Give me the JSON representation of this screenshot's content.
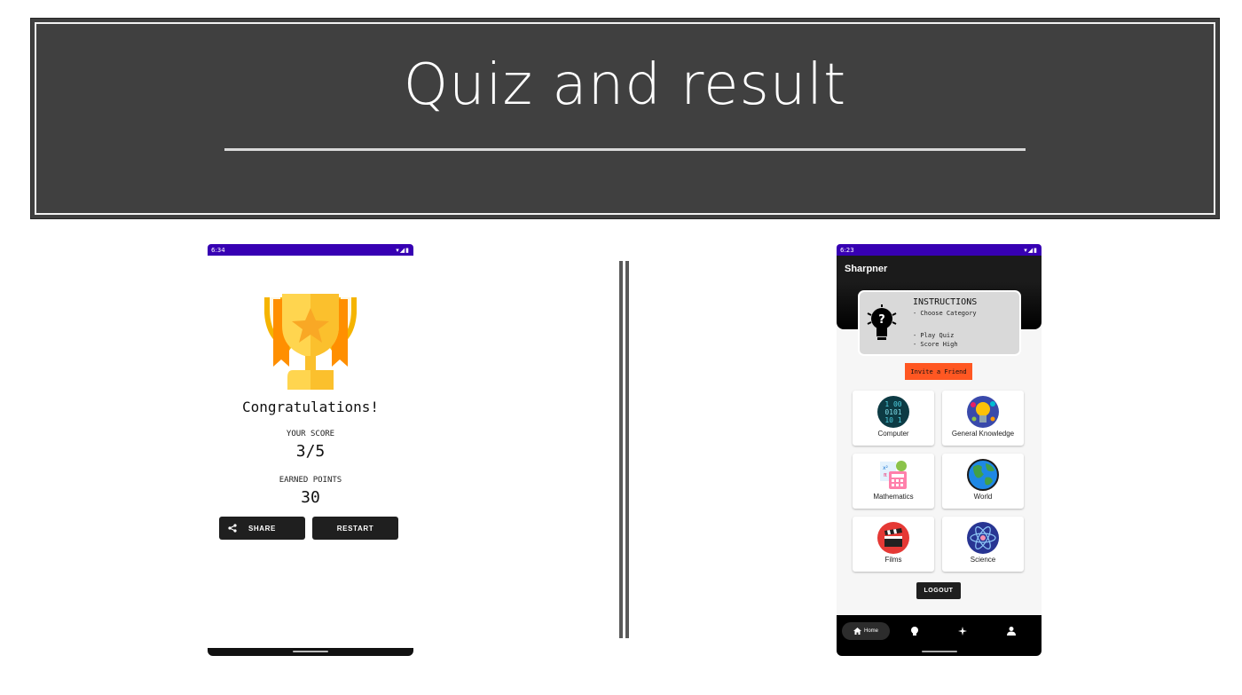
{
  "banner": {
    "title": "Quiz and result"
  },
  "left_phone": {
    "status": {
      "time": "6:34",
      "icons": "▾◢▮"
    },
    "congrats": "Congratulations!",
    "score_label": "YOUR SCORE",
    "score_value": "3/5",
    "points_label": "EARNED POINTS",
    "points_value": "30",
    "share_label": "SHARE",
    "restart_label": "RESTART",
    "icons": {
      "trophy": "trophy-icon",
      "share": "share-icon"
    }
  },
  "right_phone": {
    "status": {
      "time": "6:23",
      "icons": "▾◢▮"
    },
    "app_title": "Sharpner",
    "instructions": {
      "title": "INSTRUCTIONS",
      "line1": "- Choose Category",
      "line2": "- Play Quiz",
      "line3": "- Score High"
    },
    "invite_label": "Invite a Friend",
    "categories": [
      {
        "name": "Computer",
        "icon": "binary-code-icon"
      },
      {
        "name": "General Knowledge",
        "icon": "lightbulb-icon"
      },
      {
        "name": "Mathematics",
        "icon": "calculator-icon"
      },
      {
        "name": "World",
        "icon": "globe-icon"
      },
      {
        "name": "Films",
        "icon": "clapperboard-icon"
      },
      {
        "name": "Science",
        "icon": "atom-icon"
      }
    ],
    "logout_label": "LOGOUT",
    "bottom_nav": {
      "home_label": "Home"
    },
    "colors": {
      "status_bar": "#3700b3",
      "invite": "#ff5722",
      "app_bar": "#1b1b1b"
    }
  }
}
